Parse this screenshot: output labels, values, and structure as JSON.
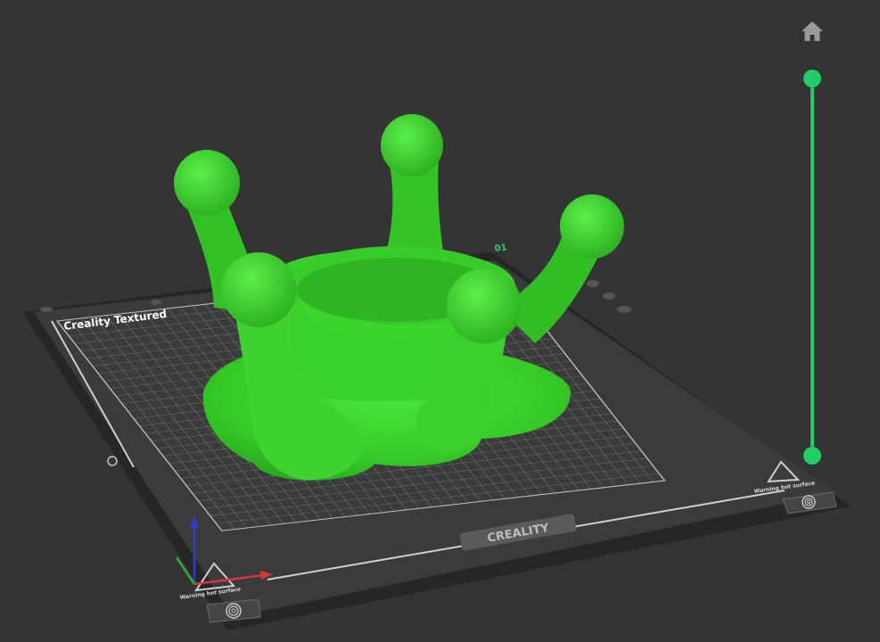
{
  "bed": {
    "label": "Creality Textured",
    "brand": "CREALITY",
    "plate_number": "01",
    "warning_left": "Warning hot surface",
    "warning_right": "Warning hot surface"
  },
  "model": {
    "color": "#39d42a"
  },
  "layer_slider": {
    "accent_color": "#1fce67",
    "upper_handle": 1.0,
    "lower_handle": 0.0
  },
  "axes": {
    "x_color": "#d43a3a",
    "y_color": "#2fae3c",
    "z_color": "#2f3bd0"
  },
  "icons": {
    "home": "home-icon",
    "fingerprint": "fingerprint-icon",
    "warning": "warning-triangle-icon"
  }
}
